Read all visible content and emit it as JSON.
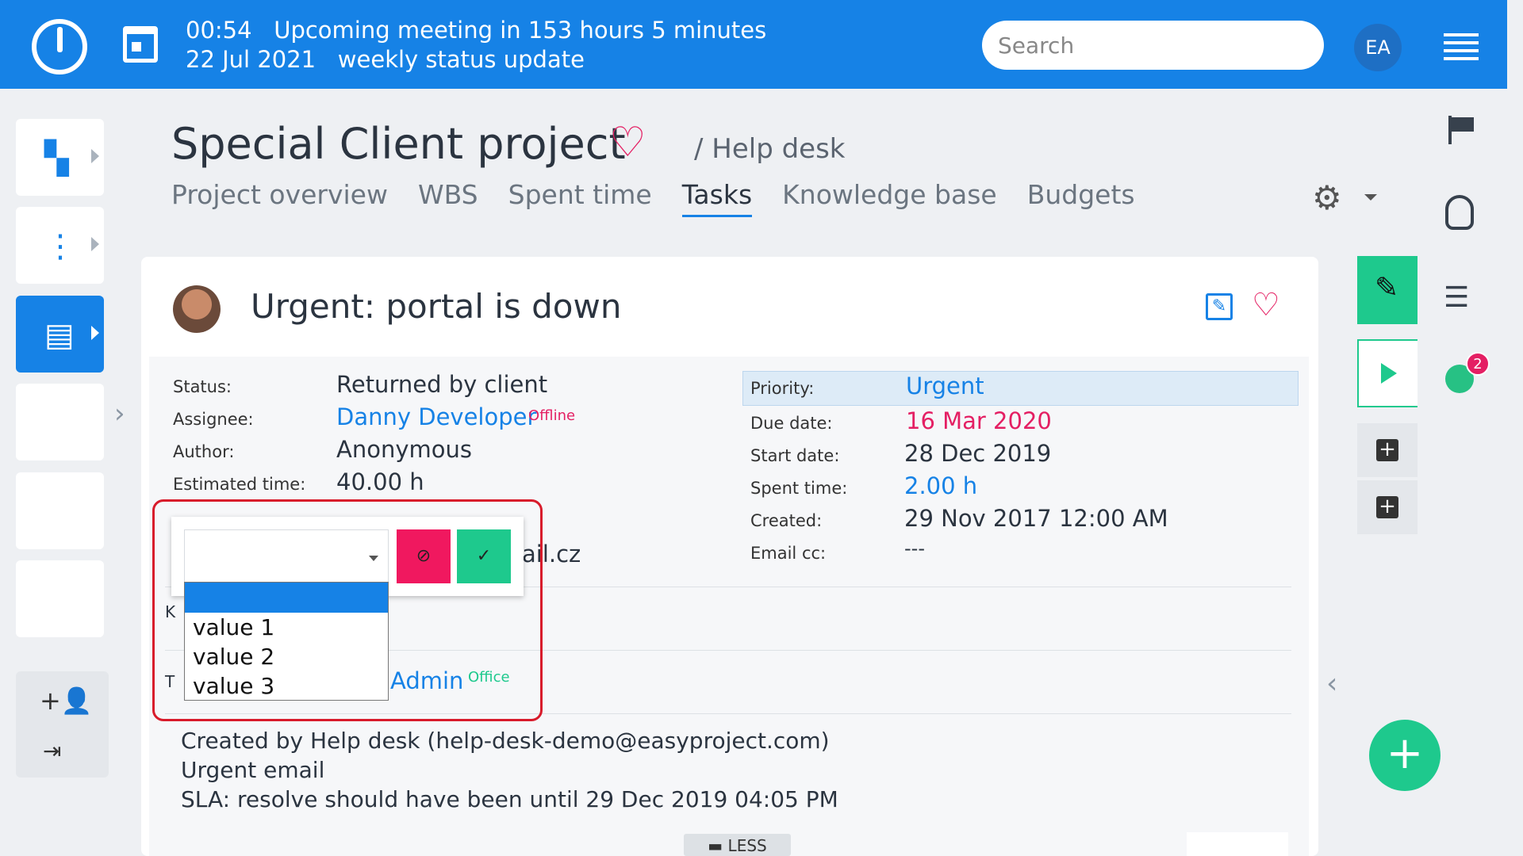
{
  "topbar": {
    "meeting_time": "00:54",
    "meeting_text": "Upcoming meeting in 153 hours 5 minutes",
    "meeting_date": "22 Jul 2021",
    "meeting_name": "weekly status update",
    "search_placeholder": "Search",
    "user_initials": "EA"
  },
  "project": {
    "title": "Special Client project",
    "breadcrumb": "/ Help desk",
    "tabs": [
      "Project overview",
      "WBS",
      "Spent time",
      "Tasks",
      "Knowledge base",
      "Budgets"
    ],
    "active_tab": "Tasks"
  },
  "issue": {
    "title": "Urgent: portal is down",
    "left": {
      "status_label": "Status:",
      "status_value": "Returned by client",
      "assignee_label": "Assignee:",
      "assignee_value": "Danny Developer",
      "assignee_presence": "Offline",
      "author_label": "Author:",
      "author_value": "Anonymous",
      "estimated_label": "Estimated time:",
      "estimated_value": "40.00 h",
      "email_fragment": "ail.cz",
      "admin_value": "Admin",
      "admin_presence": "Office",
      "k_fragment": "K",
      "t_fragment": "T"
    },
    "right": {
      "priority_label": "Priority:",
      "priority_value": "Urgent",
      "due_label": "Due date:",
      "due_value": "16 Mar 2020",
      "start_label": "Start date:",
      "start_value": "28 Dec 2019",
      "spent_label": "Spent time:",
      "spent_value": "2.00 h",
      "created_label": "Created:",
      "created_value": "29 Nov 2017 12:00 AM",
      "emailcc_label": "Email cc:",
      "emailcc_value": "---"
    },
    "description": [
      "Created by Help desk (help-desk-demo@easyproject.com)",
      "Urgent email",
      "SLA: resolve should have been until 29 Dec 2019 04:05 PM"
    ],
    "less_label": "LESS"
  },
  "editor": {
    "selected_value": "",
    "options": [
      "",
      "value 1",
      "value 2",
      "value 3"
    ]
  },
  "right_rail": {
    "timer_count": "2"
  },
  "colors": {
    "brand_blue": "#1682e6",
    "green": "#1ec98d",
    "pink": "#e41f63",
    "highlight_red": "#d81b2b"
  }
}
